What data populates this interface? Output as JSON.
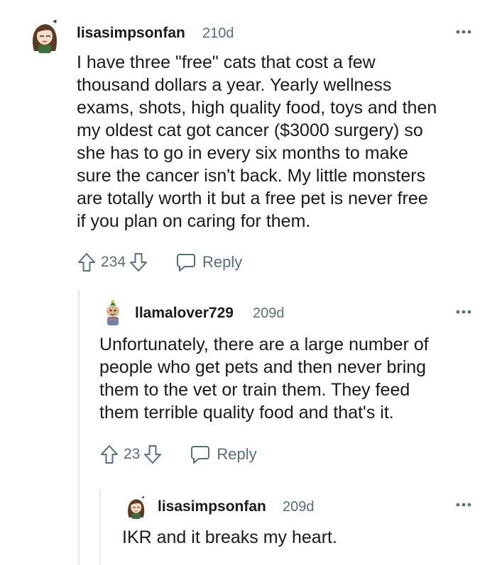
{
  "comments": [
    {
      "username": "lisasimpsonfan",
      "age": "210d",
      "body_lines": [
        "I have three \"free\" cats that cost a few",
        "thousand dollars a year. Yearly wellness",
        "exams, shots, high quality food, toys and then",
        "my oldest cat got cancer ($3000 surgery) so",
        "she has to go in every six months to make",
        "sure the cancer isn't back. My little monsters",
        "are totally worth it but a free pet is never free",
        "if you plan on caring for them."
      ],
      "score": "234",
      "reply_label": "Reply",
      "avatar_icon": "cartoon-girl-avatar-icon"
    },
    {
      "username": "llamalover729",
      "age": "209d",
      "body_lines": [
        "Unfortunately, there are a large number of",
        "people who get pets and then never bring",
        "them to the vet or train them. They feed",
        "them terrible quality food and that's it."
      ],
      "score": "23",
      "reply_label": "Reply",
      "avatar_icon": "llama-avatar-icon"
    },
    {
      "username": "lisasimpsonfan",
      "age": "209d",
      "body_lines": [
        "IKR and it breaks my heart."
      ],
      "avatar_icon": "cartoon-girl-avatar-icon"
    }
  ],
  "colors": {
    "text": "#1a1a1b",
    "muted": "#576f76",
    "thread_line": "#e5e9eb"
  }
}
